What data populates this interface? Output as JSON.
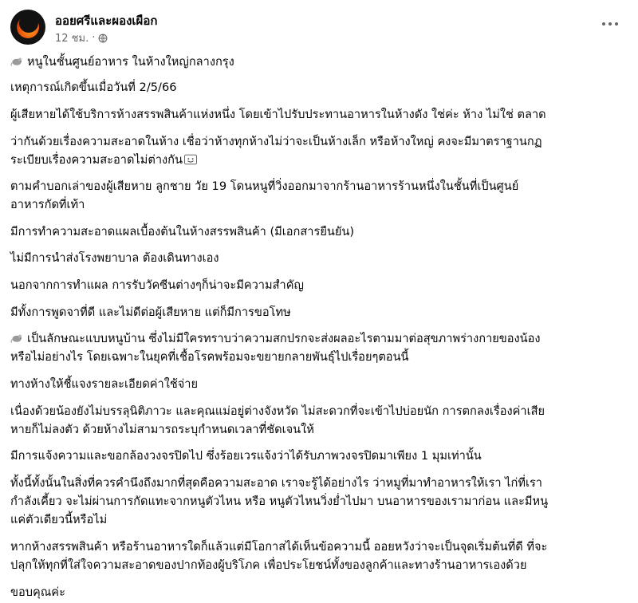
{
  "post": {
    "author": "ออยศรีและผองเผือก",
    "time": "12 ชม.",
    "separator": "·",
    "icons": {
      "privacy": "globe-icon",
      "more": "more-options-icon",
      "emoji_mouse": "mouse-emoji-icon",
      "emoji_smile": "smile-emoji-icon"
    }
  },
  "body": {
    "l1": "หนูในชั้นศูนย์อาหาร ในห้างใหญ่กลางกรุง",
    "l2": "เหตุการณ์เกิดขึ้นเมื่อวันที่ 2/5/66",
    "l3": "ผู้เสียหายได้ใช้บริการห้างสรรพสินค้าแห่งหนึ่ง โดยเข้าไปรับประทานอาหารในห้างดัง ใช่ค่ะ ห้าง ไม่ใช่ ตลาด",
    "l4": "ว่ากันด้วยเรื่องความสะอาดในห้าง เชื่อว่าห้างทุกห้างไม่ว่าจะเป็นห้างเล็ก หรือห้างใหญ่ คงจะมีมาตราฐานกฏ",
    "l5": "ระเบียบเรื่องความสะอาดไม่ต่างกัน",
    "l6": "ตามคำบอกเล่าของผู้เสียหาย ลูกชาย วัย 19 โดนหนูที่วิ่งออกมาจากร้านอาหารร้านหนึ่งในชั้นที่เป็นศูนย์",
    "l7": "อาหารกัดที่เท้า",
    "l8": "มีการทำความสะอาดแผลเบื้องต้นในห้างสรรพสินค้า (มีเอกสารยืนยัน)",
    "l9": "ไม่มีการนำส่งโรงพยาบาล ต้องเดินทางเอง",
    "l10": "นอกจากการทำแผล การรับวัคซีนต่างๆก็น่าจะมีความสำคัญ",
    "l11": "มีทั้งการพูดจาที่ดี และไม่ดีต่อผู้เสียหาย แต่ก็มีการขอโทษ",
    "l12": "เป็นลักษณะแบบหนูบ้าน ซึ่งไม่มีใครทราบว่าความสกปรกจะส่งผลอะไรตามมาต่อสุขภาพร่างกายของน้อง",
    "l13": "หรือไม่อย่างไร โดยเฉพาะในยุคที่เชื้อโรคพร้อมจะขยายกลายพันธุ์ไปเรื่อยๆตอนนี้",
    "l14": "ทางห้างให้ชี้แจงรายละเอียดค่าใช้จ่าย",
    "l15": "เนื่องด้วยน้องยังไม่บรรลุนิติภาวะ และคุณแม่อยู่ต่างจังหวัด ไม่สะดวกที่จะเข้าไปบ่อยนัก การตกลงเรื่องค่าเสีย",
    "l16": "หายก็ไม่ลงตัว ด้วยห้างไม่สามารถระบุกำหนดเวลาที่ชัดเจนให้",
    "l17": "มีการแจ้งความและขอกล้องวงจรปิดไป ซึ่งร้อยเวรแจ้งว่าได้รับภาพวงจรปิดมาเพียง 1 มุมเท่านั้น",
    "l18": "ทั้งนี้ทั้งนั้นในสิ่งที่ควรคำนึงถึงมากที่สุดคือความสะอาด เราจะรู้ได้อย่างไร ว่าหมูที่มาทำอาหารให้เรา ไก่ที่เรา",
    "l19": "กำลังเคี้ยว จะไม่ผ่านการกัดแทะจากหนูตัวไหน หรือ หนูตัวไหนวิ่งย่ำไปมา บนอาหารของเรามาก่อน และมีหนู",
    "l20": "แค่ตัวเดียวนี้หรือไม่",
    "l21": "หากห้างสรรพสินค้า หรือร้านอาหารใดก็แล้วแต่มีโอกาสได้เห็นข้อความนี้ ออยหวังว่าจะเป็นจุดเริ่มต้นที่ดี ที่จะ",
    "l22": "ปลุกให้ทุกที่ใส่ใจความสะอาดของปากท้องผู้บริโภค เพื่อประโยชน์ทั้งของลูกค้าและทางร้านอาหารเองด้วย",
    "l23": "ขอบคุณค่ะ"
  }
}
